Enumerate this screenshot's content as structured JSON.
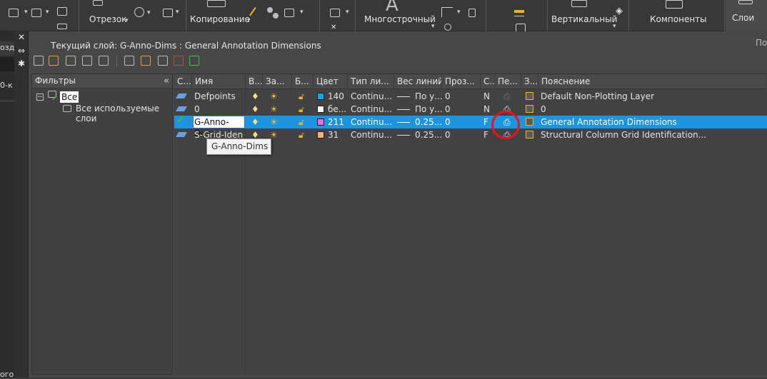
{
  "ribbon": {
    "segment_label": "Отрезок",
    "copy_label": "Копирование",
    "multiline_label": "Многострочный",
    "vertical_label": "Вертикальный",
    "components_label": "Компоненты",
    "layers_label": "Слои",
    "big_letter": "A"
  },
  "left_strip": {
    "fragment_top": "озд",
    "fragment_mid": "0-к",
    "fragment_bottom": "ого"
  },
  "palette": {
    "title": "Текущий слой: G-Anno-Dims : General Annotation Dimensions",
    "right_cut_text": "По",
    "filters": {
      "header": "Фильтры",
      "collapse_glyph": "«",
      "tree": [
        {
          "label": "Все",
          "expander": "−"
        },
        {
          "label": "Все используемые слои"
        }
      ]
    },
    "columns": [
      "С...",
      "Имя",
      "В...",
      "За...",
      "Б...",
      "Цвет",
      "Тип ли...",
      "Вес линий",
      "Проз...",
      "С...",
      "Пе...",
      "З...",
      "Пояснение"
    ],
    "rows": [
      {
        "name": "Defpoints",
        "color_num": "140",
        "color_hex": "#12a7e8",
        "linetype": "Continu...",
        "lineweight": "По у...",
        "transparency": "0",
        "style": "N",
        "description": "Default Non-Plotting Layer",
        "selected": false,
        "current": false
      },
      {
        "name": "0",
        "color_num": "бе...",
        "color_hex": "#ffffff",
        "linetype": "Continu...",
        "lineweight": "По у...",
        "transparency": "0",
        "style": "N",
        "description": "0",
        "selected": false,
        "current": false
      },
      {
        "name": "G-Anno-Dims",
        "color_num": "211",
        "color_hex": "#e86be8",
        "linetype": "Continu...",
        "lineweight": "0.25...",
        "transparency": "0",
        "style": "F",
        "description": "General Annotation Dimensions",
        "selected": true,
        "current": true
      },
      {
        "name": "S-Grid-Iden",
        "color_num": "31",
        "color_hex": "#f5b07a",
        "linetype": "Continu...",
        "lineweight": "0.25...",
        "transparency": "0",
        "style": "F",
        "description": "Structural Column Grid Identification...",
        "selected": false,
        "current": false
      }
    ],
    "tooltip": "G-Anno-Dims"
  },
  "colors": {
    "selection": "#1c94e0",
    "highlight_circle": "#e8141d",
    "current_check": "#3bc23b"
  }
}
